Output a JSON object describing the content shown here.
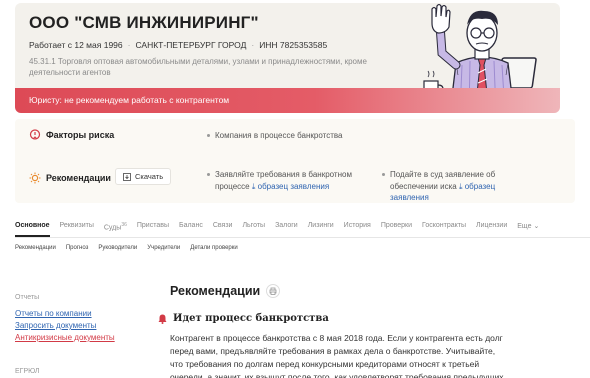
{
  "company": {
    "name": "ООО \"СМВ ИНЖИНИРИНГ\"",
    "works_since": "Работает с 12 мая 1996",
    "city": "САНКТ-ПЕТЕРБУРГ ГОРОД",
    "inn": "ИНН 7825353585",
    "okved": "45.31.1 Торговля оптовая автомобильными деталями, узлами и принадлежностями, кроме деятельности агентов",
    "warning": "Юристу: не рекомендуем работать с контрагентом"
  },
  "risk": {
    "title": "Факторы риска",
    "items": [
      "Компания в процессе банкротства"
    ]
  },
  "recommendations": {
    "title": "Рекомендации",
    "download_label": "Скачать",
    "items": [
      {
        "text": "Заявляйте требования в банкротном процессе",
        "link": "образец заявления"
      },
      {
        "text": "Подайте в суд заявление об обеспечении иска",
        "link": "образец заявления"
      }
    ]
  },
  "tabs": [
    {
      "label": "Основное",
      "active": true
    },
    {
      "label": "Реквизиты"
    },
    {
      "label": "Суды",
      "badge": "36"
    },
    {
      "label": "Приставы"
    },
    {
      "label": "Баланс"
    },
    {
      "label": "Связи"
    },
    {
      "label": "Льготы"
    },
    {
      "label": "Залоги"
    },
    {
      "label": "Лизинги"
    },
    {
      "label": "История"
    },
    {
      "label": "Проверки"
    },
    {
      "label": "Госконтракты"
    },
    {
      "label": "Лицензии"
    },
    {
      "label": "Еще"
    }
  ],
  "subtabs": [
    "Рекомендации",
    "Прогноз",
    "Руководители",
    "Учредители",
    "Детали проверки"
  ],
  "sidebar": {
    "reports_heading": "Отчеты",
    "links": [
      "Отчеты по компании",
      "Запросить документы",
      "Антикризисные документы"
    ],
    "egrul_heading": "ЕГРЮЛ"
  },
  "main": {
    "title": "Рекомендации",
    "subtitle": "Идет процесс банкротства",
    "body": "Контрагент в процессе банкротства с 8 мая 2018 года. Если у контрагента есть долг перед вами, предъявляйте требования в рамках дела о банкротстве. Учитывайте, что требования по долгам перед конкурсными кредиторами относят к третьей очереди, а значит, их взыщут после того, как удовлетворят требования предыдущих"
  },
  "colors": {
    "warning_bar": "#dd4a56",
    "link": "#2f64b0",
    "danger_text": "#d23a46",
    "card_bg": "#f3f1ec"
  }
}
